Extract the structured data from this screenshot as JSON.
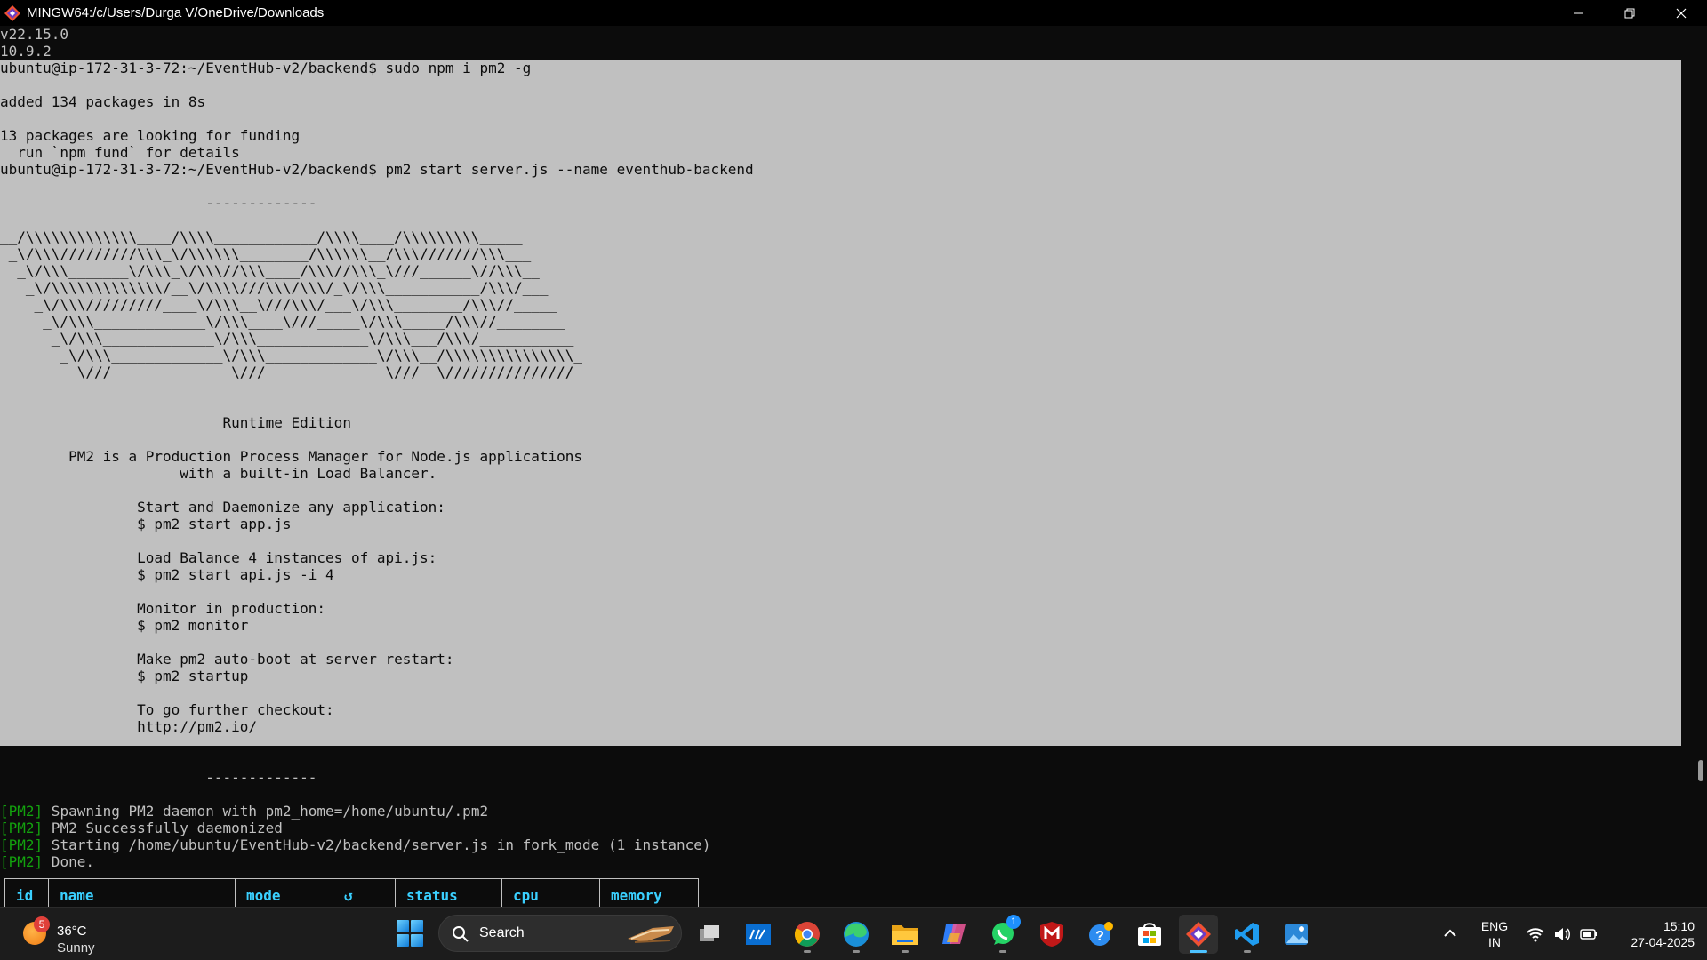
{
  "window": {
    "title": "MINGW64:/c/Users/Durga V/OneDrive/Downloads"
  },
  "terminal": {
    "lines": [
      "v22.15.0",
      "10.9.2",
      "ubuntu@ip-172-31-3-72:~/EventHub-v2/backend$ sudo npm i pm2 -g",
      "",
      "added 134 packages in 8s",
      "",
      "13 packages are looking for funding",
      "  run `npm fund` for details",
      "ubuntu@ip-172-31-3-72:~/EventHub-v2/backend$ pm2 start server.js --name eventhub-backend",
      "",
      "                        -------------",
      "",
      "__/\\\\\\\\\\\\\\\\\\\\\\\\\\____/\\\\\\\\____________/\\\\\\\\____/\\\\\\\\\\\\\\\\\\_____",
      " _\\/\\\\\\/////////\\\\\\_\\/\\\\\\\\\\\\________/\\\\\\\\\\\\__/\\\\\\///////\\\\\\___",
      "  _\\/\\\\\\_______\\/\\\\\\_\\/\\\\\\//\\\\\\____/\\\\\\//\\\\\\_\\///______\\//\\\\\\__",
      "   _\\/\\\\\\\\\\\\\\\\\\\\\\\\\\/__\\/\\\\\\\\///\\\\\\/\\\\\\/_\\/\\\\\\___________/\\\\\\/___",
      "    _\\/\\\\\\/////////____\\/\\\\\\__\\///\\\\\\/___\\/\\\\\\________/\\\\\\//_____",
      "     _\\/\\\\\\_____________\\/\\\\\\____\\///_____\\/\\\\\\_____/\\\\\\//________",
      "      _\\/\\\\\\_____________\\/\\\\\\_____________\\/\\\\\\___/\\\\\\/___________",
      "       _\\/\\\\\\_____________\\/\\\\\\_____________\\/\\\\\\__/\\\\\\\\\\\\\\\\\\\\\\\\\\\\\\_",
      "        _\\///______________\\///______________\\///__\\///////////////__",
      "",
      "",
      "                          Runtime Edition",
      "",
      "        PM2 is a Production Process Manager for Node.js applications",
      "                     with a built-in Load Balancer.",
      "",
      "                Start and Daemonize any application:",
      "                $ pm2 start app.js",
      "",
      "                Load Balance 4 instances of api.js:",
      "                $ pm2 start api.js -i 4",
      "",
      "                Monitor in production:",
      "                $ pm2 monitor",
      "",
      "                Make pm2 auto-boot at server restart:",
      "                $ pm2 startup",
      "",
      "                To go further checkout:",
      "                http://pm2.io/",
      "",
      "",
      "                        -------------",
      ""
    ],
    "log_prefix": "[PM2]",
    "log_lines": [
      " Spawning PM2 daemon with pm2_home=/home/ubuntu/.pm2",
      " PM2 Successfully daemonized",
      " Starting /home/ubuntu/EventHub-v2/backend/server.js in fork_mode (1 instance)",
      " Done."
    ],
    "table_headers": [
      "id",
      "name",
      "mode",
      "↺",
      "status",
      "cpu",
      "memory"
    ]
  },
  "taskbar": {
    "weather": {
      "temp": "36°C",
      "condition": "Sunny",
      "badge": "5"
    },
    "search_label": "Search",
    "whatsapp_badge": "1",
    "language": {
      "line1": "ENG",
      "line2": "IN"
    },
    "clock": {
      "time": "15:10",
      "date": "27-04-2025"
    }
  },
  "colors": {
    "terminal_bg": "#0c0c0c",
    "terminal_fg": "#c0c0c0",
    "selection_bg": "#c0c0c0",
    "pm2_tag": "#13a10e",
    "table_header": "#3ad0ff",
    "taskbar_bg": "#1c1c1c",
    "accent": "#4cc2ff"
  }
}
